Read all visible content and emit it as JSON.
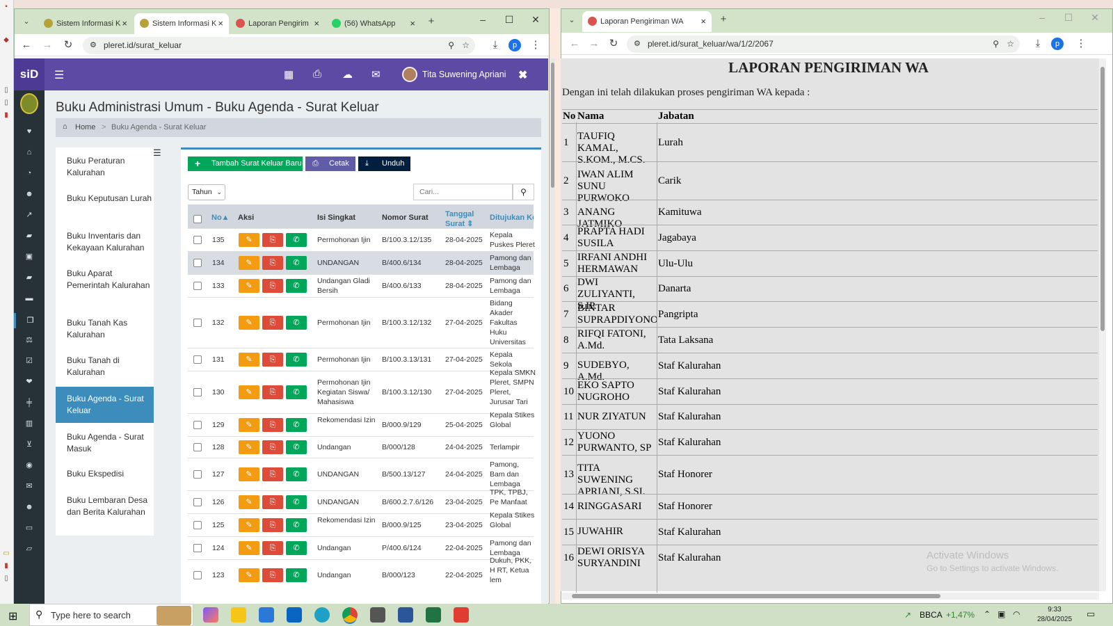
{
  "left_window": {
    "tabs": [
      "Sistem Informasi K",
      "Sistem Informasi K",
      "Laporan Pengirim",
      "(56) WhatsApp"
    ],
    "url": "pleret.id/surat_keluar",
    "profile_initial": "p"
  },
  "app": {
    "logo": "siD",
    "user_name": "Tita Suwening Apriani",
    "page_title": "Buku Administrasi Umum - Buku Agenda - Surat Keluar",
    "breadcrumb_home": "Home",
    "breadcrumb_sep": ">",
    "breadcrumb_current": "Buku Agenda - Surat Keluar",
    "menu": [
      "Buku Peraturan Kalurahan",
      "Buku Keputusan Lurah",
      "Buku Inventaris dan Kekayaan Kalurahan",
      "Buku Aparat Pemerintah Kalurahan",
      "Buku Tanah Kas Kalurahan",
      "Buku Tanah di Kalurahan",
      "Buku Agenda - Surat Keluar",
      "Buku Agenda - Surat Masuk",
      "Buku Ekspedisi",
      "Buku Lembaran Desa dan Berita Kalurahan"
    ],
    "buttons": {
      "add": "Tambah Surat Keluar Baru",
      "print": "Cetak",
      "download": "Unduh"
    },
    "year_select": "Tahun",
    "search_placeholder": "Cari...",
    "columns": [
      "No",
      "Aksi",
      "Isi Singkat",
      "Nomor Surat",
      "Tanggal Surat",
      "Ditujukan Ke"
    ],
    "rows": [
      {
        "no": "135",
        "isi": "Permohonan Ijin",
        "nomor": "B/100.3.12/135",
        "tgl": "28-04-2025",
        "ke": "Kepala Puskes Pleret"
      },
      {
        "no": "134",
        "isi": "UNDANGAN",
        "nomor": "B/400.6/134",
        "tgl": "28-04-2025",
        "ke": "Pamong dan Lembaga"
      },
      {
        "no": "133",
        "isi": "Undangan Gladi Bersih",
        "nomor": "B/400.6/133",
        "tgl": "28-04-2025",
        "ke": "Pamong dan Lembaga"
      },
      {
        "no": "132",
        "isi": "Permohonan Ijin",
        "nomor": "B/100.3.12/132",
        "tgl": "27-04-2025",
        "ke": "Bidang Akader Fakultas Huku Universitas Gajahmada Yogyakarta"
      },
      {
        "no": "131",
        "isi": "Permohonan Ijin",
        "nomor": "B/100.3.13/131",
        "tgl": "27-04-2025",
        "ke": "Kepala Sekola Kanggotan"
      },
      {
        "no": "130",
        "isi": "Permohonan Ijin Kegiatan Siswa/ Mahasiswa",
        "nomor": "B/100.3.12/130",
        "tgl": "27-04-2025",
        "ke": "Kepala SMKN Pleret, SMPN Pleret, Jurusar Tari UNY"
      },
      {
        "no": "129",
        "isi": "Rekomendasi Izin",
        "nomor": "B/000.9/129",
        "tgl": "25-04-2025",
        "ke": "Kepala Stikes Global Yogyak"
      },
      {
        "no": "128",
        "isi": "Undangan",
        "nomor": "B/000/128",
        "tgl": "24-04-2025",
        "ke": "Terlampir"
      },
      {
        "no": "127",
        "isi": "UNDANGAN",
        "nomor": "B/500.13/127",
        "tgl": "24-04-2025",
        "ke": "Pamong, Bam dan Lembaga Kalurahan"
      },
      {
        "no": "126",
        "isi": "UNDANGAN",
        "nomor": "B/600.2.7.6/126",
        "tgl": "23-04-2025",
        "ke": "TPK, TPBJ, Pe Manfaat RTLH"
      },
      {
        "no": "125",
        "isi": "Rekomendasi Izin",
        "nomor": "B/000.9/125",
        "tgl": "23-04-2025",
        "ke": "Kepala Stikes Global Yogyak"
      },
      {
        "no": "124",
        "isi": "Undangan",
        "nomor": "P/400.6/124",
        "tgl": "22-04-2025",
        "ke": "Pamong dan Lembaga Kalu"
      },
      {
        "no": "123",
        "isi": "Undangan",
        "nomor": "B/000/123",
        "tgl": "22-04-2025",
        "ke": "Dukuh, PKK, H RT, Ketua lem Kalurahan Ple"
      }
    ]
  },
  "right_window": {
    "tab": "Laporan Pengiriman WA",
    "url": "pleret.id/surat_keluar/wa/1/2/2067",
    "profile_initial": "p"
  },
  "report": {
    "title": "LAPORAN PENGIRIMAN WA",
    "intro": "Dengan ini telah dilakukan proses pengiriman WA kepada :",
    "col_no": "No",
    "col_nama": "Nama",
    "col_jabatan": "Jabatan",
    "rows": [
      {
        "no": "1",
        "nama": "TAUFIQ KAMAL, S.KOM., M.CS.",
        "jabatan": "Lurah"
      },
      {
        "no": "2",
        "nama": "IWAN ALIM SUNU PURWOKO",
        "jabatan": "Carik"
      },
      {
        "no": "3",
        "nama": "ANANG JATMIKO",
        "jabatan": "Kamituwa"
      },
      {
        "no": "4",
        "nama": "PRAPTA HADI SUSILA",
        "jabatan": "Jagabaya"
      },
      {
        "no": "5",
        "nama": "IRFANI ANDHI HERMAWAN",
        "jabatan": "Ulu-Ulu"
      },
      {
        "no": "6",
        "nama": "DWI ZULIYANTI, S.IP.",
        "jabatan": "Danarta"
      },
      {
        "no": "7",
        "nama": "BINTAR SUPRAPDIYONO",
        "jabatan": "Pangripta"
      },
      {
        "no": "8",
        "nama": "RIFQI FATONI, A.Md.",
        "jabatan": "Tata Laksana"
      },
      {
        "no": "9",
        "nama": "SUDEBYO, A.Md.",
        "jabatan": "Staf Kalurahan"
      },
      {
        "no": "10",
        "nama": "EKO SAPTO NUGROHO",
        "jabatan": "Staf Kalurahan"
      },
      {
        "no": "11",
        "nama": "NUR ZIYATUN",
        "jabatan": "Staf Kalurahan"
      },
      {
        "no": "12",
        "nama": "YUONO PURWANTO, SP",
        "jabatan": "Staf Kalurahan"
      },
      {
        "no": "13",
        "nama": "TITA SUWENING APRIANI, S.SI.",
        "jabatan": "Staf Honorer"
      },
      {
        "no": "14",
        "nama": "RINGGASARI",
        "jabatan": "Staf Honorer"
      },
      {
        "no": "15",
        "nama": "JUWAHIR",
        "jabatan": "Staf Kalurahan"
      },
      {
        "no": "16",
        "nama": "DEWI ORISYA SURYANDINI",
        "jabatan": "Staf Kalurahan"
      }
    ],
    "watermark_title": "Activate Windows",
    "watermark_sub": "Go to Settings to activate Windows."
  },
  "taskbar": {
    "search": "Type here to search",
    "stock_name": "BBCA",
    "stock_change": "+1,47%",
    "time": "9:33",
    "date": "28/04/2025"
  },
  "colors": {
    "accent": "#5d4aa5",
    "green": "#00a65a",
    "orange": "#f39c12",
    "red": "#dd4b39",
    "navy": "#001f3f",
    "blue": "#3c8dbc"
  }
}
